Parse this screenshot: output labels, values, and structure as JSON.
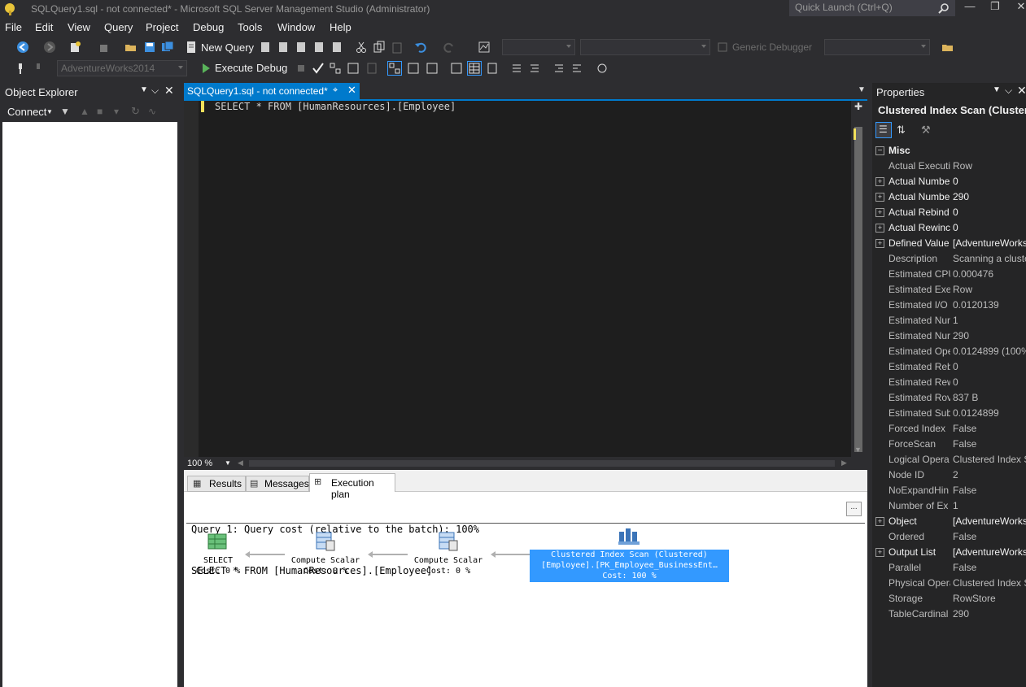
{
  "window": {
    "title": "SQLQuery1.sql - not connected* - Microsoft SQL Server Management Studio (Administrator)",
    "quick_launch_placeholder": "Quick Launch (Ctrl+Q)"
  },
  "menu": [
    "File",
    "Edit",
    "View",
    "Query",
    "Project",
    "Debug",
    "Tools",
    "Window",
    "Help"
  ],
  "toolbar": {
    "new_query": "New Query",
    "generic_debugger": "Generic Debugger",
    "database": "AdventureWorks2014",
    "execute": "Execute",
    "debug": "Debug"
  },
  "object_explorer": {
    "title": "Object Explorer",
    "connect": "Connect"
  },
  "editor": {
    "tab_title": "SQLQuery1.sql - not connected*",
    "code": "SELECT * FROM [HumanResources].[Employee]",
    "zoom": "100 %"
  },
  "results": {
    "tabs": [
      "Results",
      "Messages",
      "Execution plan"
    ],
    "header_line1": "Query 1: Query cost (relative to the batch): 100%",
    "header_line2": "SELECT * FROM [HumanResources].[Employee]",
    "nodes": [
      {
        "name": "SELECT",
        "cost": "Cost: 0 %"
      },
      {
        "name": "Compute Scalar",
        "cost": "Cost: 0 %"
      },
      {
        "name": "Compute Scalar",
        "cost": "Cost: 0 %"
      },
      {
        "name": "Clustered Index Scan (Clustered)",
        "detail": "[Employee].[PK_Employee_BusinessEnt…",
        "cost": "Cost: 100 %"
      }
    ]
  },
  "properties": {
    "title": "Properties",
    "object": "Clustered Index Scan (Clusterec",
    "category": "Misc",
    "rows": [
      {
        "name": "Actual Executi",
        "value": "Row",
        "expand": false
      },
      {
        "name": "Actual Numbe",
        "value": "0",
        "expand": true
      },
      {
        "name": "Actual Numbe",
        "value": "290",
        "expand": true
      },
      {
        "name": "Actual Rebind",
        "value": "0",
        "expand": true
      },
      {
        "name": "Actual Rewinc",
        "value": "0",
        "expand": true
      },
      {
        "name": "Defined Value",
        "value": "[AdventureWorks",
        "expand": true
      },
      {
        "name": "Description",
        "value": "Scanning a cluste",
        "expand": false
      },
      {
        "name": "Estimated CPU",
        "value": "0.000476",
        "expand": false
      },
      {
        "name": "Estimated Exe",
        "value": "Row",
        "expand": false
      },
      {
        "name": "Estimated I/O",
        "value": "0.0120139",
        "expand": false
      },
      {
        "name": "Estimated Nur",
        "value": "1",
        "expand": false
      },
      {
        "name": "Estimated Nur",
        "value": "290",
        "expand": false
      },
      {
        "name": "Estimated Ope",
        "value": "0.0124899 (100%)",
        "expand": false
      },
      {
        "name": "Estimated Reb",
        "value": "0",
        "expand": false
      },
      {
        "name": "Estimated Rew",
        "value": "0",
        "expand": false
      },
      {
        "name": "Estimated Rov",
        "value": "837 B",
        "expand": false
      },
      {
        "name": "Estimated Sub",
        "value": "0.0124899",
        "expand": false
      },
      {
        "name": "Forced Index",
        "value": "False",
        "expand": false
      },
      {
        "name": "ForceScan",
        "value": "False",
        "expand": false
      },
      {
        "name": "Logical Opera",
        "value": "Clustered Index S",
        "expand": false
      },
      {
        "name": "Node ID",
        "value": "2",
        "expand": false
      },
      {
        "name": "NoExpandHin",
        "value": "False",
        "expand": false
      },
      {
        "name": "Number of Ex",
        "value": "1",
        "expand": false
      },
      {
        "name": "Object",
        "value": "[AdventureWorks",
        "expand": true
      },
      {
        "name": "Ordered",
        "value": "False",
        "expand": false
      },
      {
        "name": "Output List",
        "value": "[AdventureWorks",
        "expand": true
      },
      {
        "name": "Parallel",
        "value": "False",
        "expand": false
      },
      {
        "name": "Physical Opera",
        "value": "Clustered Index S",
        "expand": false
      },
      {
        "name": "Storage",
        "value": "RowStore",
        "expand": false
      },
      {
        "name": "TableCardinal",
        "value": "290",
        "expand": false
      }
    ]
  },
  "colors": {
    "accent": "#007acc",
    "selected_node": "#3399ff"
  }
}
